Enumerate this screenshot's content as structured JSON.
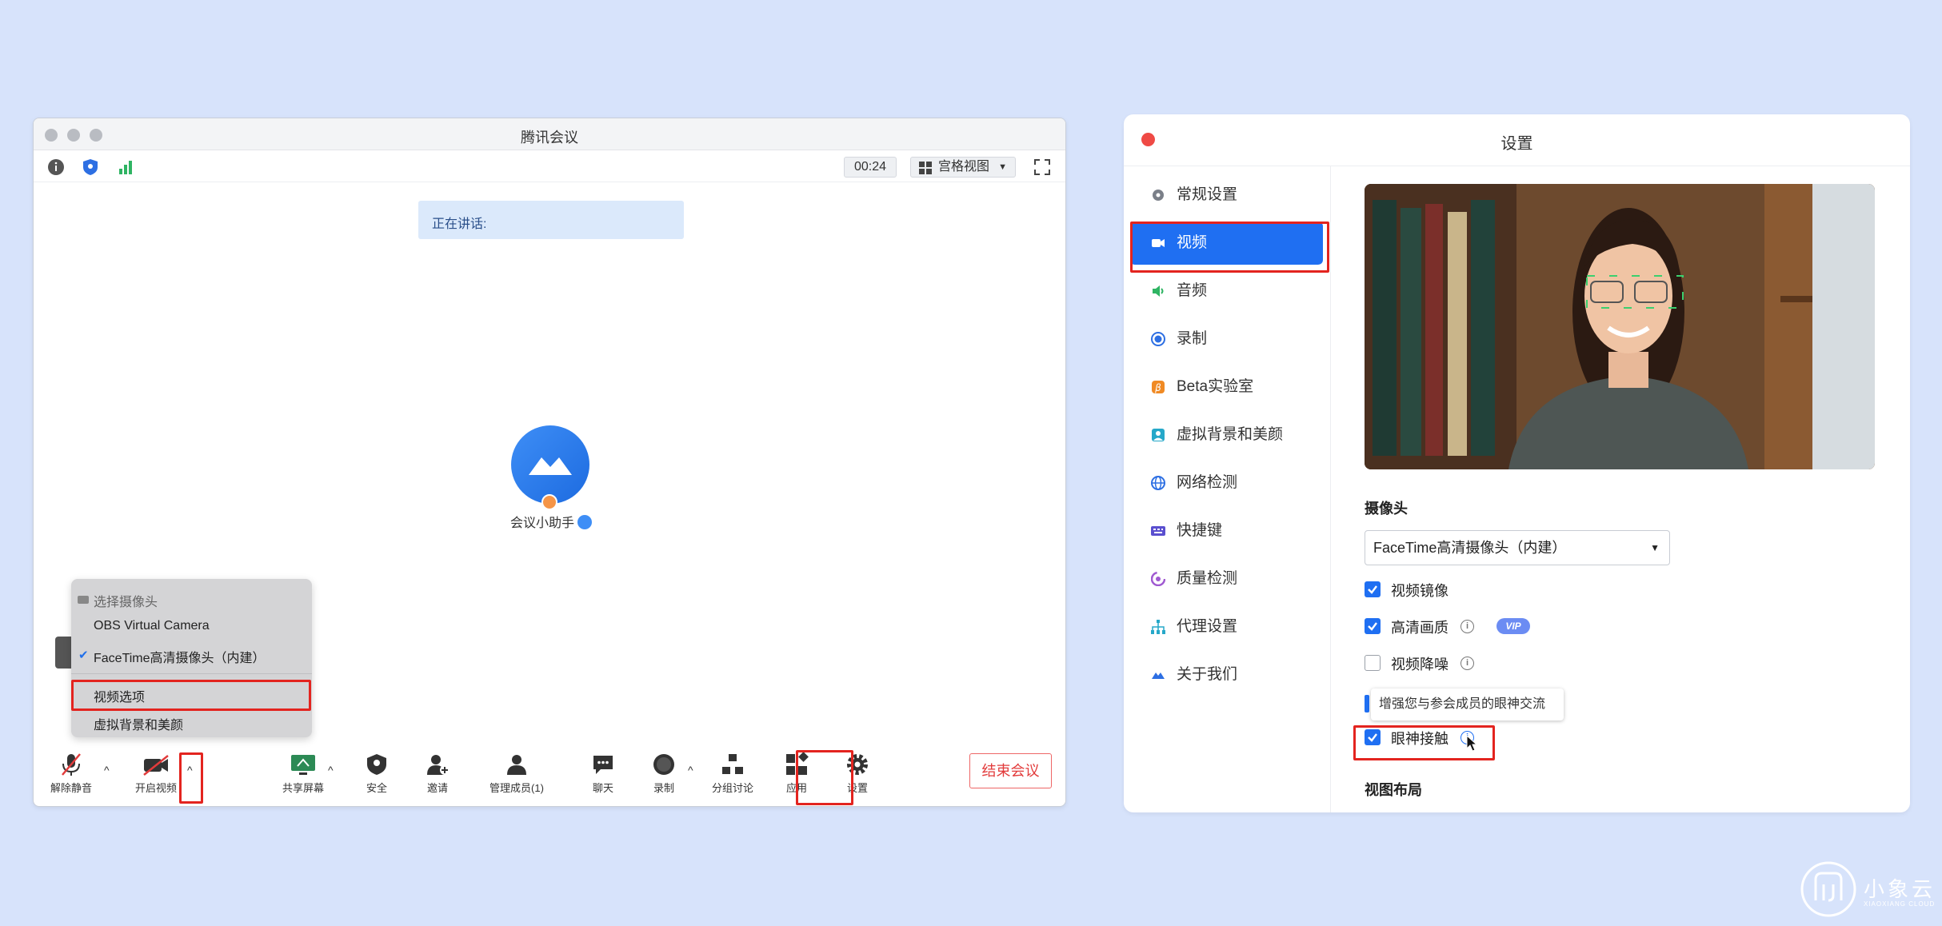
{
  "meeting": {
    "title": "腾讯会议",
    "timer": "00:24",
    "view_mode": "宫格视图",
    "speaking_label": "正在讲话:",
    "assistant_name": "会议小助手",
    "camera_menu": {
      "header": "选择摄像头",
      "items": [
        "OBS Virtual Camera",
        "FaceTime高清摄像头（内建）"
      ],
      "selected_index": 1,
      "video_options": "视频选项",
      "virtual_bg": "虚拟背景和美颜"
    },
    "toolbar": {
      "unmute": "解除静音",
      "start_video": "开启视频",
      "share_screen": "共享屏幕",
      "security": "安全",
      "invite": "邀请",
      "manage_members": "管理成员(1)",
      "chat": "聊天",
      "record": "录制",
      "breakout": "分组讨论",
      "apps": "应用",
      "settings": "设置",
      "end_meeting": "结束会议"
    }
  },
  "settings": {
    "title": "设置",
    "nav": [
      {
        "label": "常规设置",
        "icon": "gear-icon",
        "color": "#7a7f88"
      },
      {
        "label": "视频",
        "icon": "video-camera-icon",
        "color": "#ffffff"
      },
      {
        "label": "音频",
        "icon": "speaker-icon",
        "color": "#2fb463"
      },
      {
        "label": "录制",
        "icon": "record-icon",
        "color": "#2d6fe3"
      },
      {
        "label": "Beta实验室",
        "icon": "beta-icon",
        "color": "#f08a24"
      },
      {
        "label": "虚拟背景和美颜",
        "icon": "portrait-icon",
        "color": "#26a8c9"
      },
      {
        "label": "网络检测",
        "icon": "globe-icon",
        "color": "#2d6fe3"
      },
      {
        "label": "快捷键",
        "icon": "keyboard-icon",
        "color": "#5a4fcf"
      },
      {
        "label": "质量检测",
        "icon": "quality-icon",
        "color": "#a05ad1"
      },
      {
        "label": "代理设置",
        "icon": "network-tree-icon",
        "color": "#26a8c9"
      },
      {
        "label": "关于我们",
        "icon": "meeting-logo-icon",
        "color": "#2d6fe3"
      }
    ],
    "active_index": 1,
    "camera_section": "摄像头",
    "camera_selected": "FaceTime高清摄像头（内建）",
    "options": [
      {
        "label": "视频镜像",
        "checked": true
      },
      {
        "label": "高清画质",
        "checked": true,
        "badge": "VIP"
      },
      {
        "label": "视频降噪",
        "checked": false
      },
      {
        "label": "眼神接触",
        "checked": true
      }
    ],
    "tooltip": "增强您与参会成员的眼神交流",
    "layout_section": "视图布局"
  },
  "brand": {
    "name": "小象云",
    "sub": "XIAOXIANG CLOUD"
  }
}
